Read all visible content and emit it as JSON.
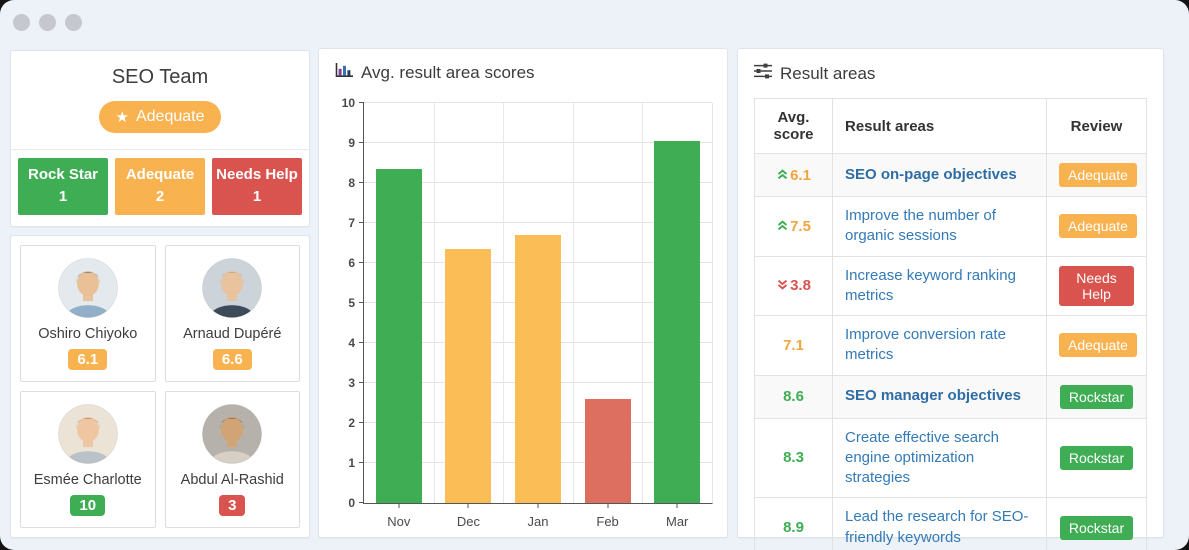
{
  "window": {
    "dot_count": 3,
    "dot_color": "#c5c8ce",
    "background": "#edf1f8"
  },
  "team_panel": {
    "title": "SEO Team",
    "badge": {
      "label": "Adequate",
      "icon": "star-icon",
      "color": "#f8b250"
    },
    "summary": [
      {
        "label": "Rock Star",
        "count": "1",
        "color": "#3fad53"
      },
      {
        "label": "Adequate",
        "count": "2",
        "color": "#f8b250"
      },
      {
        "label": "Needs Help",
        "count": "1",
        "color": "#d9534f"
      }
    ]
  },
  "members": [
    {
      "name": "Oshiro Chiyoko",
      "score": "6.1",
      "score_color": "#f8b250",
      "avatar": {
        "bg": "#e4e9ee",
        "skin": "#eac197",
        "hair": "#2b2320",
        "shirt": "#8fb0c6"
      }
    },
    {
      "name": "Arnaud Dupéré",
      "score": "6.6",
      "score_color": "#f8b250",
      "avatar": {
        "bg": "#ccd3d9",
        "skin": "#e9c29e",
        "hair": "#a87f57",
        "shirt": "#3c4a59"
      }
    },
    {
      "name": "Esmée Charlotte",
      "score": "10",
      "score_color": "#3fad53",
      "avatar": {
        "bg": "#eae3d6",
        "skin": "#f0c6a2",
        "hair": "#6b4a34",
        "shirt": "#b9c2c8"
      }
    },
    {
      "name": "Abdul Al-Rashid",
      "score": "3",
      "score_color": "#d9534f",
      "avatar": {
        "bg": "#b6b1ab",
        "skin": "#d2a375",
        "hair": "#27211c",
        "shirt": "#d8cfc6"
      }
    }
  ],
  "chart_panel": {
    "title": "Avg. result area scores",
    "icon": "bar-chart-icon"
  },
  "chart_data": {
    "type": "bar",
    "title": "Avg. result area scores",
    "categories": [
      "Nov",
      "Dec",
      "Jan",
      "Feb",
      "Mar"
    ],
    "values": [
      8.35,
      6.35,
      6.7,
      2.6,
      9.05
    ],
    "bar_colors": [
      "#3fad53",
      "#fbbd55",
      "#fbbd55",
      "#dd6f61",
      "#3fad53"
    ],
    "xlabel": "",
    "ylabel": "",
    "ylim": [
      0,
      10
    ],
    "yticks": [
      0,
      1,
      2,
      3,
      4,
      5,
      6,
      7,
      8,
      9,
      10
    ],
    "grid": true,
    "legend": false
  },
  "results_panel": {
    "title": "Result areas",
    "icon": "sliders-icon",
    "table": {
      "headers": [
        "Avg. score",
        "Result areas",
        "Review"
      ],
      "rows": [
        {
          "score": "6.1",
          "score_color": "#f0a63d",
          "trend": "up",
          "label": "SEO on-page objectives",
          "bold": true,
          "review": "Adequate",
          "review_color": "#f8b250"
        },
        {
          "score": "7.5",
          "score_color": "#f0a63d",
          "trend": "up",
          "label": "Improve the number of organic sessions",
          "bold": false,
          "review": "Adequate",
          "review_color": "#f8b250"
        },
        {
          "score": "3.8",
          "score_color": "#d9534f",
          "trend": "down",
          "label": "Increase keyword ranking metrics",
          "bold": false,
          "review": "Needs Help",
          "review_color": "#d9534f"
        },
        {
          "score": "7.1",
          "score_color": "#f0a63d",
          "trend": "none",
          "label": "Improve conversion rate metrics",
          "bold": false,
          "review": "Adequate",
          "review_color": "#f8b250"
        },
        {
          "score": "8.6",
          "score_color": "#3fad53",
          "trend": "none",
          "label": "SEO manager objectives",
          "bold": true,
          "review": "Rockstar",
          "review_color": "#3fad53"
        },
        {
          "score": "8.3",
          "score_color": "#3fad53",
          "trend": "none",
          "label": "Create effective search engine optimization strategies",
          "bold": false,
          "review": "Rockstar",
          "review_color": "#3fad53"
        },
        {
          "score": "8.9",
          "score_color": "#3fad53",
          "trend": "none",
          "label": "Lead the research for SEO-friendly keywords",
          "bold": false,
          "review": "Rockstar",
          "review_color": "#3fad53"
        }
      ]
    }
  },
  "colors": {
    "green": "#3fad53",
    "orange": "#f8b250",
    "red": "#d9534f",
    "link_blue": "#337ab7",
    "bold_link_blue": "#2e6da4",
    "trend_up": "#3fad53",
    "trend_down": "#d9534f"
  }
}
